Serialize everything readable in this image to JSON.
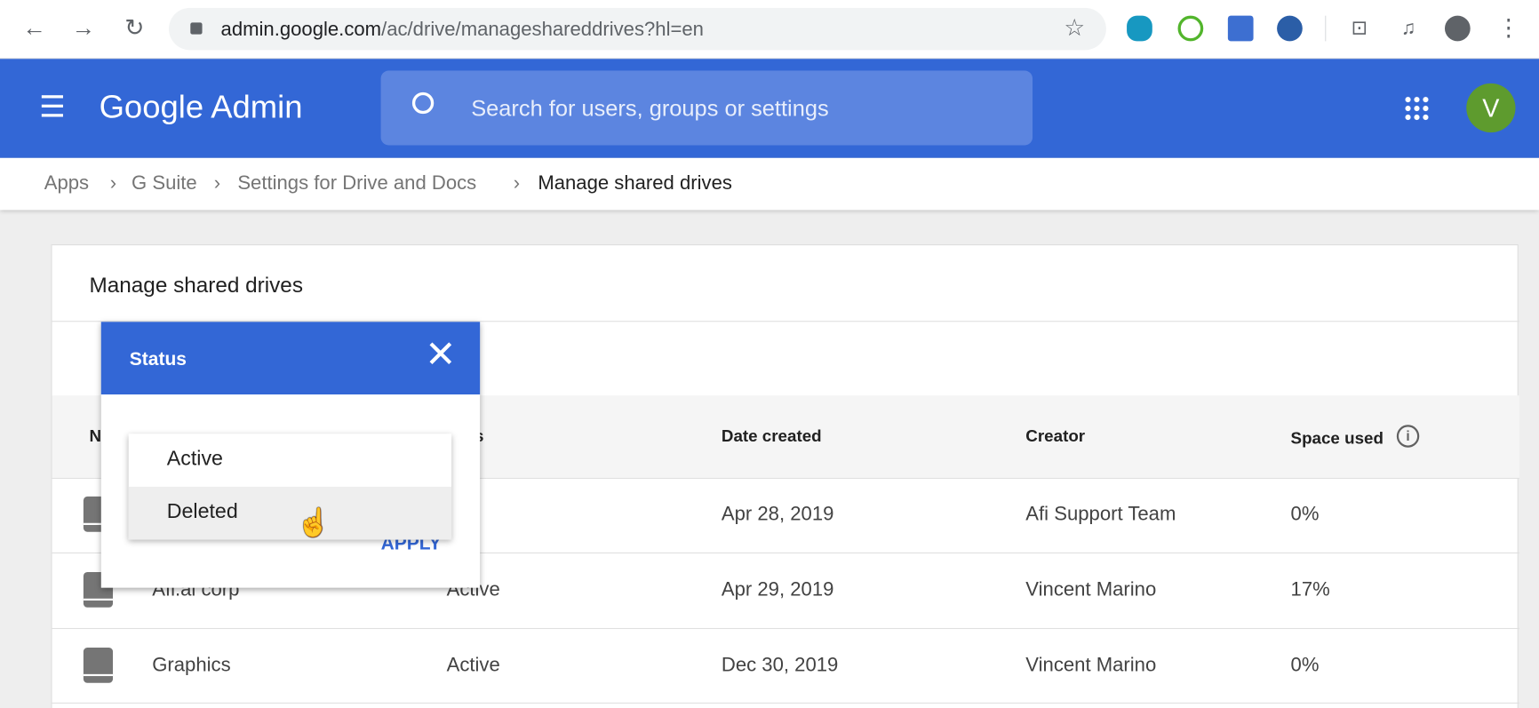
{
  "browser": {
    "url_host": "admin.google.com",
    "url_path": "/ac/drive/manageshareddrives?hl=en"
  },
  "header": {
    "logo": "Google Admin",
    "search_placeholder": "Search for users, groups or settings",
    "avatar_letter": "V",
    "brand_color": "#3367d6"
  },
  "breadcrumb": [
    "Apps",
    "G Suite",
    "Settings for Drive and Docs",
    "Manage shared drives"
  ],
  "card": {
    "title": "Manage shared drives"
  },
  "table": {
    "columns": [
      "N",
      "us",
      "Date created",
      "Creator",
      "Space used"
    ],
    "rows": [
      {
        "name": "",
        "status": "ive",
        "date": "Apr 28, 2019",
        "creator": "Afi Support Team",
        "space": "0%"
      },
      {
        "name": "Afi.ai corp",
        "status": "Active",
        "date": "Apr 29, 2019",
        "creator": "Vincent Marino",
        "space": "17%"
      },
      {
        "name": "Graphics",
        "status": "Active",
        "date": "Dec 30, 2019",
        "creator": "Vincent Marino",
        "space": "0%"
      }
    ]
  },
  "filter_popup": {
    "title": "Status",
    "options": [
      "Active",
      "Deleted"
    ],
    "hovered": "Deleted",
    "apply": "APPLY"
  }
}
